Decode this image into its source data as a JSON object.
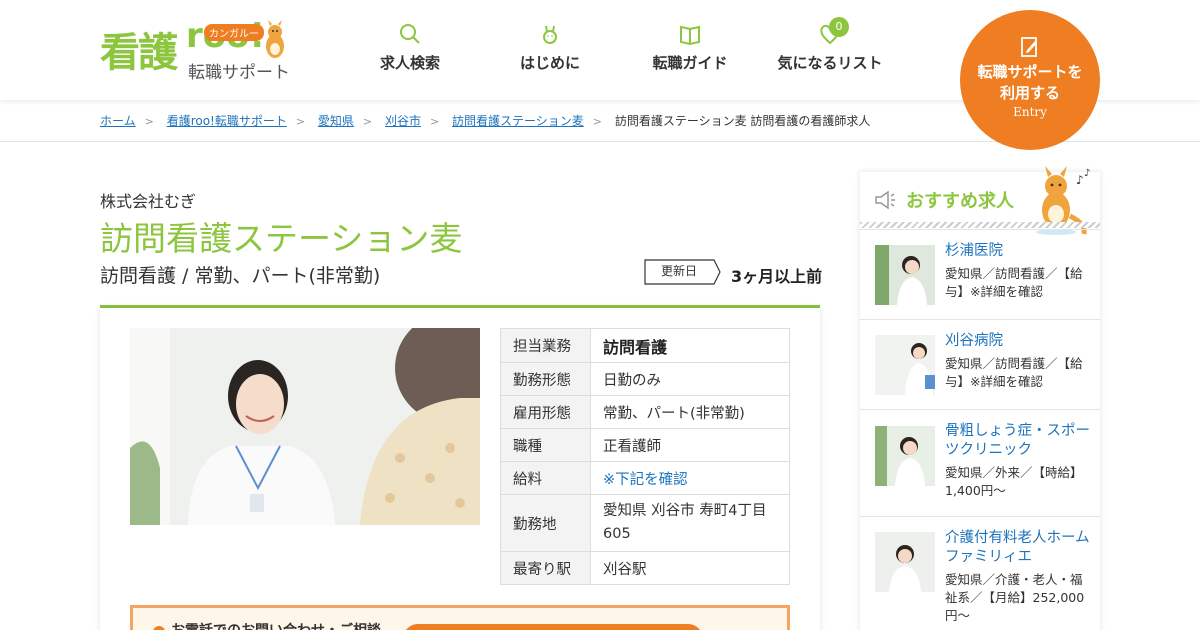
{
  "brand": {
    "logo_main": "看護",
    "logo_roo": "roo!",
    "logo_badge": "カンガルー",
    "logo_sub": "転職サポート",
    "accent_green": "#8cc63f",
    "accent_orange": "#ef7d22"
  },
  "nav": {
    "items": [
      {
        "label": "求人検索",
        "icon": "search-icon"
      },
      {
        "label": "はじめに",
        "icon": "kangaroo-icon"
      },
      {
        "label": "転職ガイド",
        "icon": "book-icon"
      },
      {
        "label": "気になるリスト",
        "icon": "heart-icon",
        "badge": "0"
      }
    ],
    "entry": {
      "label": "転職サポートを利用する",
      "sub": "Entry",
      "icon": "edit-icon"
    }
  },
  "breadcrumb": {
    "items": [
      "ホーム",
      "看護roo!転職サポート",
      "愛知県",
      "刈谷市",
      "訪問看護ステーション麦"
    ],
    "current": "訪問看護ステーション麦 訪問看護の看護師求人"
  },
  "job": {
    "company": "株式会社むぎ",
    "title": "訪問看護ステーション麦",
    "subtitle": "訪問看護 / 常勤、パート(非常勤)",
    "updated_label": "更新日",
    "updated_value": "3ヶ月以上前",
    "details": [
      {
        "key": "担当業務",
        "value": "訪問看護"
      },
      {
        "key": "勤務形態",
        "value": "日勤のみ"
      },
      {
        "key": "雇用形態",
        "value": "常勤、パート(非常勤)"
      },
      {
        "key": "職種",
        "value": "正看護師"
      },
      {
        "key": "給料",
        "value": "※下記を確認"
      },
      {
        "key": "勤務地",
        "value": "愛知県 刈谷市 寿町4丁目605"
      },
      {
        "key": "最寄り駅",
        "value": "刈谷駅"
      }
    ],
    "promo_text": "お電話でのお問い合わせ・ご相談"
  },
  "sidebar": {
    "title": "おすすめ求人",
    "jobs": [
      {
        "name": "杉浦医院",
        "meta": "愛知県／訪問看護／【給与】※詳細を確認"
      },
      {
        "name": "刈谷病院",
        "meta": "愛知県／訪問看護／【給与】※詳細を確認"
      },
      {
        "name": "骨粗しょう症・スポーツクリニック",
        "meta": "愛知県／外来／【時給】1,400円〜"
      },
      {
        "name": "介護付有料老人ホームファミリィエ",
        "meta": "愛知県／介護・老人・福祉系／【月給】252,000円〜"
      }
    ]
  }
}
